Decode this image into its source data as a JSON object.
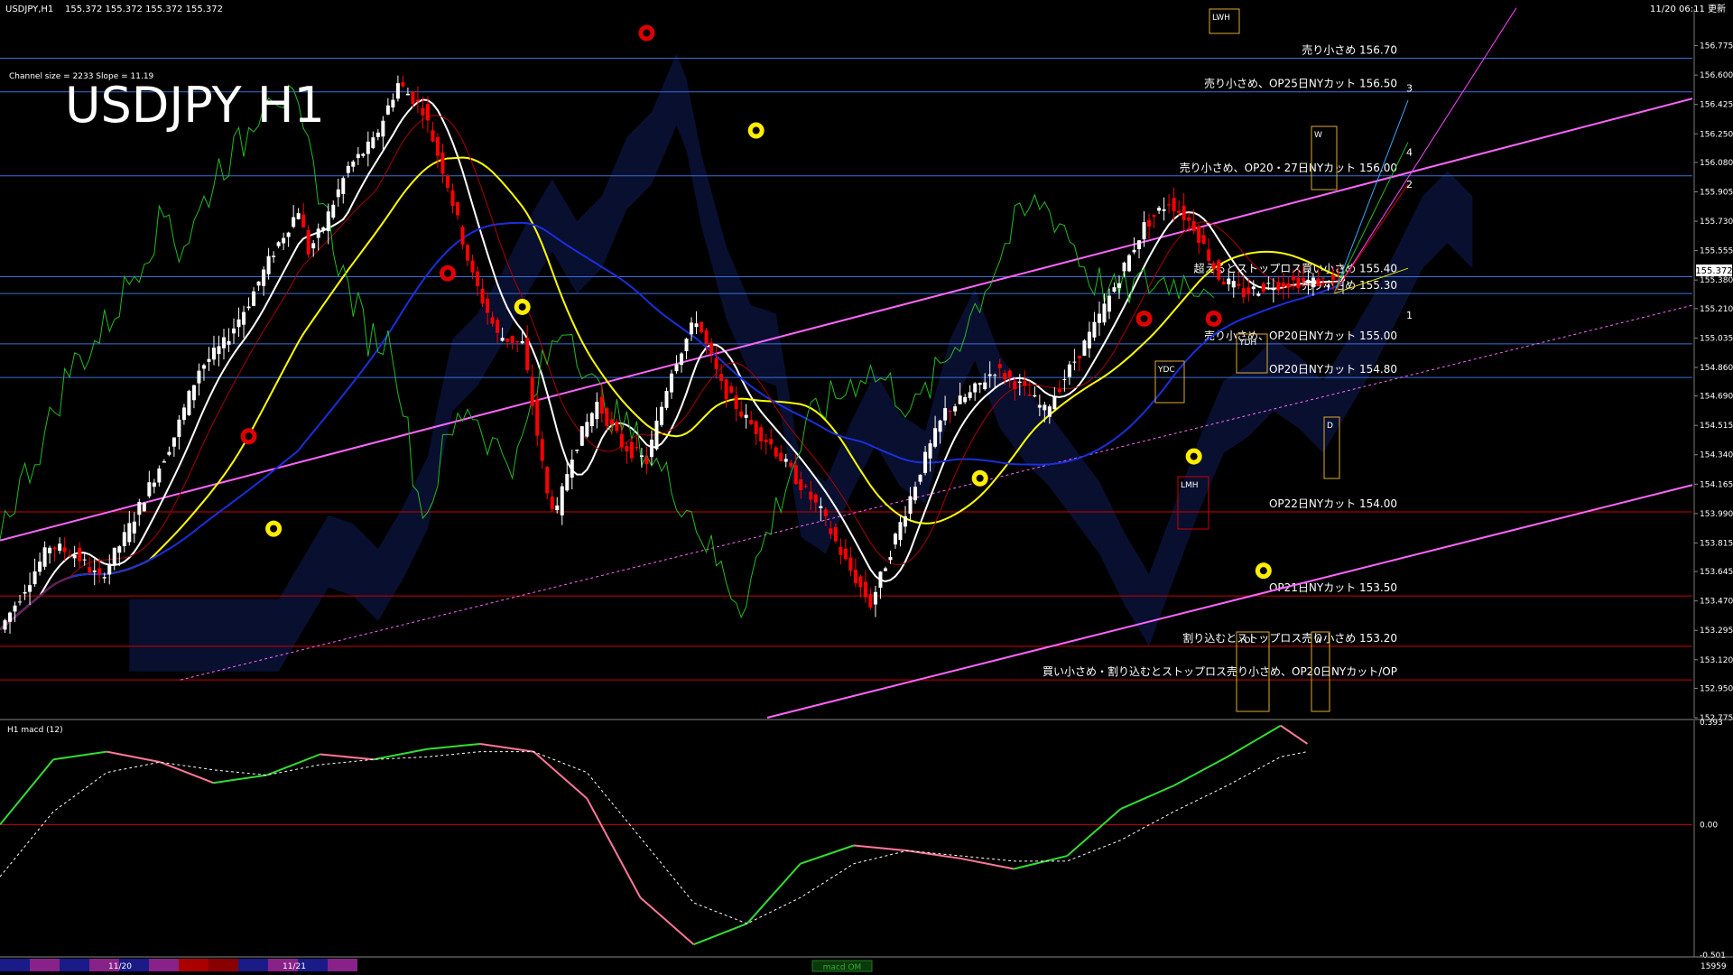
{
  "window": {
    "title": "USDJPY,H1",
    "ohlc": "155.372 155.372 155.372 155.372",
    "time": "11/20 06:11 更新",
    "channel_info": "Channel size = 2233 Slope = 11.19",
    "big_title": "USDJPY H1"
  },
  "colors": {
    "background": "#000000",
    "bull_candle": "#ffffff",
    "bear_candle": "#ff0000",
    "blue_line": "#3a6fd8",
    "red_line": "#cc0000",
    "pink_channel": "#ff66ff",
    "yellow_ma": "#ffff00",
    "white_ma": "#ffffff",
    "blue_ma": "#1a2fdd",
    "green_line": "#22bb22",
    "macd_up": "#33dd33",
    "macd_down": "#ff7799",
    "price_tag_bg": "#ffffff"
  },
  "chart_data": [
    {
      "type": "line",
      "series": [
        {
          "name": "",
          "x": [
            0,
            5,
            10,
            15,
            20,
            25,
            30,
            35,
            40,
            45,
            50,
            55,
            60,
            62,
            65,
            70,
            75,
            80,
            85,
            90,
            95,
            100,
            105,
            110,
            112,
            115,
            120,
            125,
            130,
            135,
            140,
            145,
            150,
            155,
            160,
            165,
            170,
            175,
            180,
            185,
            190,
            195,
            200,
            205,
            210,
            215,
            220,
            225,
            230,
            235,
            240,
            245,
            250,
            255,
            260,
            265,
            270
          ],
          "y": [
            153.3,
            153.55,
            153.8,
            153.75,
            153.6,
            153.85,
            154.15,
            154.45,
            154.85,
            155.0,
            155.25,
            155.55,
            155.8,
            155.55,
            155.7,
            156.05,
            156.2,
            156.55,
            156.4,
            155.95,
            155.4,
            155.05,
            155.0,
            154.1,
            154.0,
            154.35,
            154.65,
            154.4,
            154.3,
            154.85,
            155.15,
            154.75,
            154.55,
            154.4,
            154.2,
            154.0,
            153.7,
            153.45,
            153.85,
            154.25,
            154.6,
            154.7,
            154.85,
            154.75,
            154.6,
            154.85,
            155.1,
            155.4,
            155.7,
            155.85,
            155.7,
            155.4,
            155.3,
            155.35,
            155.37,
            155.37,
            155.37
          ]
        }
      ],
      "levels": [
        {
          "price": 156.7,
          "label": "売り小さめ 156.70",
          "color": "#3a6fd8"
        },
        {
          "price": 156.5,
          "label": "売り小さめ、OP25日NYカット 156.50",
          "color": "#3a6fd8"
        },
        {
          "price": 156.0,
          "label": "売り小さめ、OP20・27日NYカット 156.00",
          "color": "#3a6fd8"
        },
        {
          "price": 155.4,
          "label": "超えるとストップロス買い小さめ 155.40",
          "color": "#3a6fd8"
        },
        {
          "price": 155.3,
          "label": "売り小さめ 155.30",
          "color": "#3a6fd8"
        },
        {
          "price": 155.0,
          "label": "売り小さめ、OP20日NYカット 155.00",
          "color": "#3a6fd8"
        },
        {
          "price": 154.8,
          "label": "OP20日NYカット 154.80",
          "color": "#3a6fd8"
        },
        {
          "price": 154.0,
          "label": "OP22日NYカット 154.00",
          "color": "#cc0000"
        },
        {
          "price": 153.5,
          "label": "OP21日NYカット 153.50",
          "color": "#cc0000"
        },
        {
          "price": 153.2,
          "label": "割り込むとストップロス売り小さめ 153.20",
          "color": "#cc0000"
        },
        {
          "price": 153.0,
          "label": "買い小さめ・割り込むとストップロス売り小さめ、OP20日NYカット/OP",
          "color": "#cc0000"
        }
      ],
      "ylim": [
        152.775,
        156.95
      ],
      "y_ticks": [
        "156.775",
        "156.600",
        "156.425",
        "156.250",
        "156.080",
        "155.905",
        "155.730",
        "155.555",
        "155.380",
        "155.210",
        "155.035",
        "154.860",
        "154.690",
        "154.515",
        "154.340",
        "154.165",
        "153.990",
        "153.815",
        "153.645",
        "153.470",
        "153.295",
        "153.120",
        "152.950",
        "152.775"
      ],
      "current_price": "155.372",
      "box_labels": [
        "LWH",
        "YDC",
        "YDH",
        "YDL",
        "LMH",
        "D",
        "W",
        "W"
      ],
      "fib_labels": [
        "3",
        "4",
        "2",
        "1"
      ]
    },
    {
      "type": "line",
      "title": "H1 macd (12)",
      "series": [
        {
          "name": "",
          "x": [
            0,
            10,
            20,
            30,
            40,
            50,
            60,
            70,
            80,
            90,
            100,
            110,
            120,
            130,
            140,
            150,
            160,
            170,
            180,
            190,
            200,
            210,
            220,
            230,
            240,
            245
          ],
          "y": [
            0.0,
            0.25,
            0.28,
            0.24,
            0.16,
            0.19,
            0.27,
            0.25,
            0.29,
            0.31,
            0.28,
            0.1,
            -0.28,
            -0.46,
            -0.38,
            -0.15,
            -0.08,
            -0.1,
            -0.13,
            -0.17,
            -0.12,
            0.06,
            0.15,
            0.26,
            0.38,
            0.31
          ]
        },
        {
          "name": "",
          "x": [
            0,
            10,
            20,
            30,
            40,
            50,
            60,
            70,
            80,
            90,
            100,
            110,
            120,
            130,
            140,
            150,
            160,
            170,
            180,
            190,
            200,
            210,
            220,
            230,
            240,
            245
          ],
          "y": [
            -0.2,
            0.05,
            0.2,
            0.24,
            0.21,
            0.19,
            0.23,
            0.25,
            0.26,
            0.28,
            0.28,
            0.2,
            -0.05,
            -0.3,
            -0.38,
            -0.28,
            -0.15,
            -0.1,
            -0.12,
            -0.14,
            -0.14,
            -0.06,
            0.05,
            0.15,
            0.26,
            0.28
          ]
        }
      ],
      "ylim": [
        -0.501,
        0.393
      ],
      "y_ticks": [
        "0.393",
        "0.00",
        "-0.501"
      ],
      "zero_level": 0
    }
  ],
  "time_axis": {
    "labels": [
      "11/20",
      "11/21"
    ],
    "indicator": "macd OM",
    "right_value": "15959"
  }
}
